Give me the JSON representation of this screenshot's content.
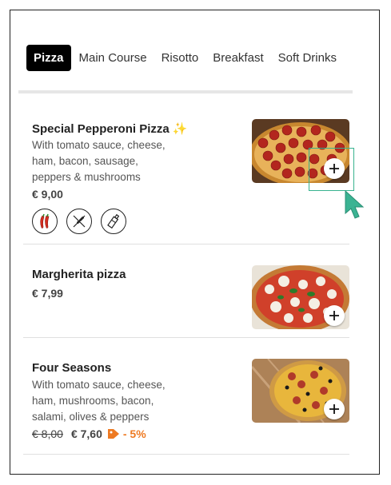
{
  "tabs": [
    {
      "label": "Pizza",
      "active": true
    },
    {
      "label": "Main Course",
      "active": false
    },
    {
      "label": "Risotto",
      "active": false
    },
    {
      "label": "Breakfast",
      "active": false
    },
    {
      "label": "Soft Drinks",
      "active": false
    }
  ],
  "items": [
    {
      "title": "Special Pepperoni Pizza",
      "title_emoji": "✨",
      "description": "With tomato sauce, cheese, ham, bacon, sausage, peppers & mushrooms",
      "price": "€ 9,00",
      "badges": [
        "chili-peppers-icon",
        "wheat-icon",
        "bottle-icon"
      ],
      "image": "pepperoni-pizza-image"
    },
    {
      "title": "Margherita pizza",
      "price": "€ 7,99",
      "image": "margherita-pizza-image"
    },
    {
      "title": "Four Seasons",
      "description": "With tomato sauce, cheese, ham, mushrooms, bacon, salami, olives & peppers",
      "old_price": "€ 8,00",
      "price": "€ 7,60",
      "discount": "- 5%",
      "image": "four-seasons-pizza-image"
    }
  ],
  "colors": {
    "active_tab_bg": "#000000",
    "discount": "#ee7a22",
    "highlight": "#38b28f",
    "cursor": "#38b28f"
  }
}
